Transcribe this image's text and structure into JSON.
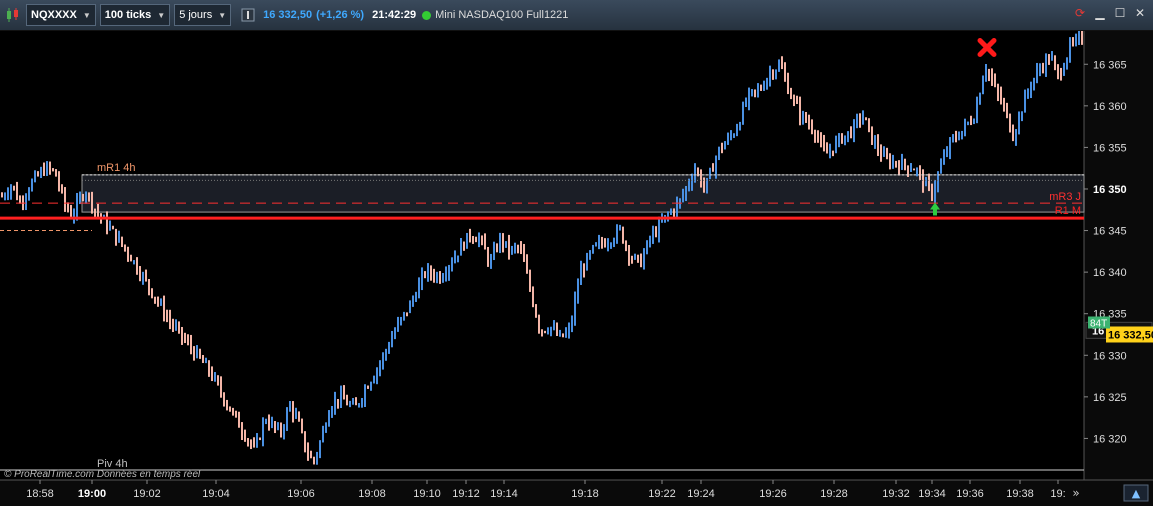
{
  "toolbar": {
    "instrument": "NQXXXX",
    "ticks": "100 ticks",
    "period": "5 jours",
    "price": "16 332,50",
    "change": "(+1,26 %)",
    "time": "21:42:29",
    "name": "Mini NASDAQ100 Full1221",
    "icons": [
      "candlestick-icon",
      "refresh-icon",
      "minimize-icon",
      "maximize-icon",
      "close-icon"
    ]
  },
  "watermark": "© ProRealTime.com  Données en temps réel",
  "colors": {
    "up": "#4a90e2",
    "down": "#f4b6a8",
    "level_red": "#ff2020",
    "bg": "#000000",
    "last_price_bg": "#ffd21a",
    "tag_bg": "#3cb371"
  },
  "chart_data": {
    "type": "bar",
    "ylim": [
      16315,
      16369
    ],
    "y_ticks": [
      16320,
      16325,
      16330,
      16335,
      16340,
      16345,
      16350,
      16355,
      16360,
      16365
    ],
    "y_tick_labels": [
      "16 320",
      "16 325",
      "16 330",
      "16 335",
      "16 340",
      "16 345",
      "16 350",
      "16 355",
      "16 360",
      "16 365"
    ],
    "x_labels": [
      "18:58",
      "19:00",
      "19:02",
      "19:04",
      "19:06",
      "19:08",
      "19:10",
      "19:12",
      "19:14",
      "19:18",
      "19:22",
      "19:24",
      "19:26",
      "19:28",
      "19:32",
      "19:34",
      "19:36",
      "19:38",
      "19:"
    ],
    "x_bold": "19:00",
    "path": [
      [
        0,
        16348.8
      ],
      [
        12,
        16350.6
      ],
      [
        20,
        16348.3
      ],
      [
        30,
        16350.5
      ],
      [
        45,
        16352.5
      ],
      [
        55,
        16352.0
      ],
      [
        65,
        16348.0
      ],
      [
        72,
        16346.8
      ],
      [
        85,
        16350.0
      ],
      [
        95,
        16347.5
      ],
      [
        110,
        16345.2
      ],
      [
        130,
        16342.0
      ],
      [
        150,
        16338.0
      ],
      [
        170,
        16334.0
      ],
      [
        190,
        16331.0
      ],
      [
        210,
        16328.0
      ],
      [
        230,
        16323.5
      ],
      [
        245,
        16320.5
      ],
      [
        255,
        16318.5
      ],
      [
        265,
        16322.5
      ],
      [
        280,
        16320.5
      ],
      [
        290,
        16324.0
      ],
      [
        298,
        16322.0
      ],
      [
        305,
        16319.0
      ],
      [
        313,
        16317.0
      ],
      [
        320,
        16319.5
      ],
      [
        330,
        16324.0
      ],
      [
        340,
        16325.0
      ],
      [
        355,
        16323.5
      ],
      [
        365,
        16326.0
      ],
      [
        380,
        16329.0
      ],
      [
        395,
        16333.0
      ],
      [
        410,
        16336.0
      ],
      [
        425,
        16340.0
      ],
      [
        440,
        16339.5
      ],
      [
        455,
        16342.0
      ],
      [
        470,
        16344.5
      ],
      [
        480,
        16344.0
      ],
      [
        490,
        16341.0
      ],
      [
        500,
        16344.0
      ],
      [
        510,
        16342.5
      ],
      [
        520,
        16343.0
      ],
      [
        530,
        16338.0
      ],
      [
        540,
        16333.0
      ],
      [
        550,
        16333.5
      ],
      [
        560,
        16332.0
      ],
      [
        570,
        16333.0
      ],
      [
        580,
        16340.0
      ],
      [
        595,
        16343.0
      ],
      [
        610,
        16344.0
      ],
      [
        620,
        16345.0
      ],
      [
        630,
        16342.0
      ],
      [
        640,
        16341.0
      ],
      [
        650,
        16344.0
      ],
      [
        665,
        16346.5
      ],
      [
        680,
        16348.5
      ],
      [
        695,
        16352.5
      ],
      [
        705,
        16350.0
      ],
      [
        718,
        16354.5
      ],
      [
        735,
        16357.0
      ],
      [
        748,
        16361.0
      ],
      [
        760,
        16362.0
      ],
      [
        770,
        16364.0
      ],
      [
        780,
        16365.0
      ],
      [
        790,
        16361.5
      ],
      [
        800,
        16359.0
      ],
      [
        815,
        16357.0
      ],
      [
        825,
        16354.0
      ],
      [
        840,
        16356.0
      ],
      [
        852,
        16357.0
      ],
      [
        862,
        16359.0
      ],
      [
        872,
        16356.0
      ],
      [
        885,
        16353.5
      ],
      [
        900,
        16353.0
      ],
      [
        915,
        16352.5
      ],
      [
        925,
        16350.5
      ],
      [
        932,
        16349.5
      ],
      [
        940,
        16352.5
      ],
      [
        950,
        16355.5
      ],
      [
        962,
        16357.0
      ],
      [
        975,
        16359.0
      ],
      [
        985,
        16365.0
      ],
      [
        995,
        16362.0
      ],
      [
        1003,
        16360.0
      ],
      [
        1013,
        16356.5
      ],
      [
        1020,
        16359.0
      ],
      [
        1030,
        16362.5
      ],
      [
        1040,
        16364.5
      ],
      [
        1050,
        16366.0
      ],
      [
        1058,
        16363.5
      ],
      [
        1070,
        16367.0
      ],
      [
        1080,
        16368.0
      ]
    ],
    "levels": [
      {
        "label": "mR1 4h",
        "value": 16351.7,
        "color": "#f0966a",
        "style": "dotted-box"
      },
      {
        "label": "mR3 J",
        "value": 16348.3,
        "color": "#ff3030",
        "style": "dashed"
      },
      {
        "label": "R1 M",
        "value": 16346.5,
        "color": "#ff2020",
        "style": "solid-thick"
      },
      {
        "label": "Piv 4h",
        "value": 16316.2,
        "color": "#c0c0c0",
        "style": "solid-thin"
      },
      {
        "label": "",
        "value": 16345.0,
        "color": "#f0966a",
        "style": "short-dashed"
      }
    ],
    "last_price": {
      "label": "16 332,50",
      "value": 16332.5
    },
    "prev_price": {
      "label": "16 333,00",
      "value": 16333.0
    },
    "tag": "84T",
    "markers": [
      {
        "type": "sell",
        "icon": "red-x-icon",
        "value": 16367.5
      },
      {
        "type": "buy",
        "icon": "green-up-arrow-icon",
        "value": 16348.5
      }
    ]
  }
}
